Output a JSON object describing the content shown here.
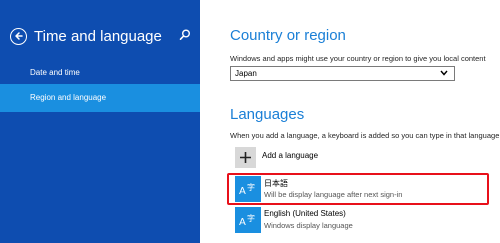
{
  "sidebar": {
    "title": "Time and language",
    "items": [
      {
        "label": "Date and time",
        "selected": false
      },
      {
        "label": "Region and language",
        "selected": true
      }
    ]
  },
  "region": {
    "heading": "Country or region",
    "description": "Windows and apps might use your country or region to give you local content",
    "selected_country": "Japan"
  },
  "languages": {
    "heading": "Languages",
    "description": "When you add a language, a keyboard is added so you can type in that language",
    "add_label": "Add a language",
    "list": [
      {
        "name": "日本語",
        "status": "Will be display language after next sign-in"
      },
      {
        "name": "English (United States)",
        "status": "Windows display language"
      }
    ]
  },
  "colors": {
    "sidebar_bg": "#0e4db0",
    "selected_bg": "#1a8fe0",
    "accent": "#1a7fd6",
    "highlight": "#e8101a"
  },
  "icons": [
    "back-arrow-icon",
    "search-icon",
    "chevron-down-icon",
    "plus-icon",
    "language-icon"
  ]
}
